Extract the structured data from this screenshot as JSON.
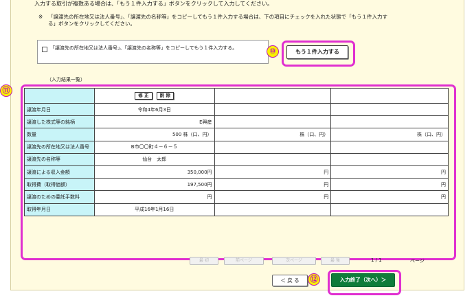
{
  "instructions": {
    "line1": "入力する取引が複数ある場合は、「もう１件入力する」ボタンをクリックして入力してください。",
    "note_mark": "※",
    "note_text": "「譲渡先の所在地又は法人番号」、「譲渡先の名称等」をコピーしてもう１件入力する場合は、下の項目にチェックを入れた状態で「もう１件入力する」ボタンをクリックしてください。"
  },
  "copy_option": {
    "label": "「譲渡先の所在地又は法人番号」、「譲渡先の名称等」をコピーしてもう１件入力する。",
    "checked": false
  },
  "badges": {
    "b10": "⑩",
    "b11": "⑪",
    "b12": "⑫"
  },
  "add_button_label": "もう１件入力する",
  "list_label": "（入力結果一覧）",
  "table": {
    "edit_label": "修 正",
    "delete_label": "削 除",
    "rows": [
      {
        "label": "譲渡年月日",
        "c1": "令和4年6月3日",
        "c2": "",
        "c3": ""
      },
      {
        "label": "譲渡した株式等の銘柄",
        "c1": "E興産",
        "c2": "",
        "c3": ""
      },
      {
        "label": "数量",
        "c1": "500 株（口、円）",
        "c2": "株（口、円）",
        "c3": "株（口、円）"
      },
      {
        "label": "譲渡先の所在地又は法人番号",
        "c1": "B市〇〇町４－６－５",
        "c2": "",
        "c3": ""
      },
      {
        "label": "譲渡先の名称等",
        "c1": "仙台　太郎",
        "c2": "",
        "c3": ""
      },
      {
        "label": "譲渡による収入金額",
        "c1": "350,000円",
        "c2": "円",
        "c3": "円"
      },
      {
        "label": "取得費（取得価額）",
        "c1": "197,500円",
        "c2": "円",
        "c3": "円"
      },
      {
        "label": "譲渡のための委託手数料",
        "c1": "円",
        "c2": "円",
        "c3": "円"
      },
      {
        "label": "取得年月日",
        "c1": "平成16年1月16日",
        "c2": "",
        "c3": ""
      }
    ]
  },
  "pager": {
    "first": "最 初",
    "prev": "前ページ",
    "next": "次ページ",
    "last": "最 後",
    "page_num": "1 / 1",
    "page_label": "ページ"
  },
  "nav": {
    "back_label": "＜ 戻 る",
    "done_label": "入力終了（次へ）＞"
  }
}
